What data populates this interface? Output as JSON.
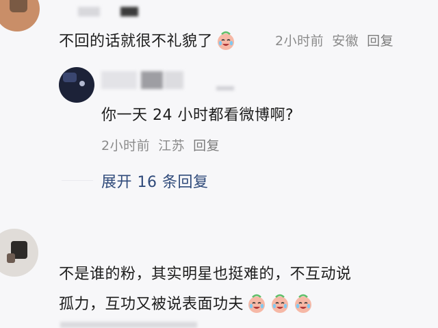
{
  "comments": [
    {
      "text": "不回的话就很不礼貌了",
      "emoji": "crying-laughing-icon",
      "meta": {
        "time": "2小时前",
        "location": "安徽",
        "reply": "回复"
      }
    },
    {
      "text": "你一天 24 小时都看微博啊?",
      "meta": {
        "time": "2小时前",
        "location": "江苏",
        "reply": "回复"
      }
    }
  ],
  "expand_label": "展开 16 条回复",
  "comment3": {
    "line1": "不是谁的粉，其实明星也挺难的，不互动说",
    "line2": "孤力，互功又被说表面功夫",
    "emoji": "crying-laughing-icon"
  },
  "colors": {
    "background": "#f7f7f9",
    "text": "#1c1c1c",
    "meta": "#8a8a8a",
    "link": "#2f4a7a"
  }
}
